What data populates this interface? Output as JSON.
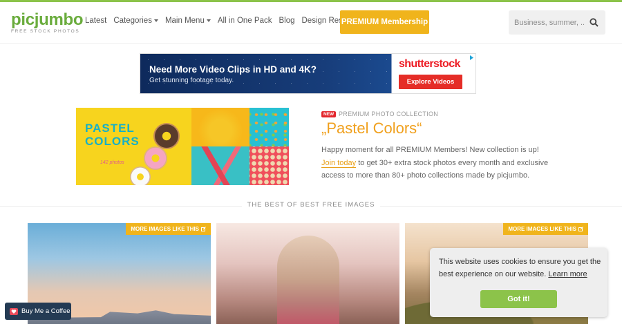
{
  "header": {
    "logo_word": "picjumbo",
    "logo_sub": "FREE STOCK PHOTOS",
    "nav": [
      {
        "label": "Latest",
        "caret": false
      },
      {
        "label": "Categories",
        "caret": true
      },
      {
        "label": "Main Menu",
        "caret": true
      },
      {
        "label": "All in One Pack",
        "caret": false
      },
      {
        "label": "Blog",
        "caret": false
      },
      {
        "label": "Design Resources",
        "caret": false
      }
    ],
    "premium_label": "PREMIUM Membership",
    "search_placeholder": "Business, summer, ..."
  },
  "ad": {
    "title": "Need More Video Clips in HD and 4K?",
    "subtitle": "Get stunning footage today.",
    "brand": "shutterstock",
    "button": "Explore Videos"
  },
  "collection": {
    "badge": "NEW",
    "label": "PREMIUM PHOTO COLLECTION",
    "title": "„Pastel Colors“",
    "text_before": "Happy moment for all PREMIUM Members! New collection is up! ",
    "link": "Join today",
    "text_after": " to get 30+ extra stock photos every month and exclusive access to more than 80+ photo collections made by picjumbo.",
    "image_title_line1": "PASTEL",
    "image_title_line2": "COLORS",
    "image_subtitle": "142 photos"
  },
  "section": {
    "title": "THE BEST OF BEST FREE IMAGES"
  },
  "gallery": {
    "more_label": "MORE IMAGES LIKE THIS"
  },
  "cookie": {
    "text": "This website uses cookies to ensure you get the best experience on our website. ",
    "link": "Learn more",
    "button": "Got it!"
  },
  "coffee": {
    "label": "Buy Me a Coffee"
  },
  "colors": {
    "brand_green": "#6aac3d",
    "premium_yellow": "#f0b41c",
    "title_orange": "#f0a01d",
    "cookie_green": "#8cc34a"
  },
  "icons": [
    "search-icon",
    "caret-down-icon",
    "external-link-icon",
    "heart-icon",
    "ad-choices-icon"
  ]
}
